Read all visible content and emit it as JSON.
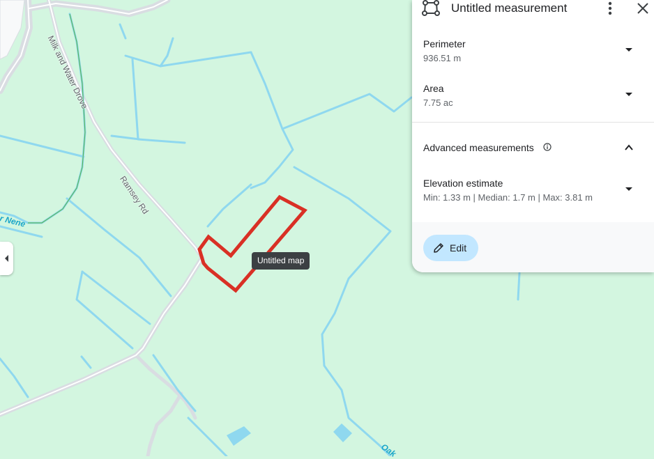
{
  "map": {
    "road_labels": {
      "milk_and_water_drove": "Milk and Water Drove",
      "ramsey_rd": "Ramsey Rd"
    },
    "water_labels": {
      "river_nene_partial": "r Nene",
      "oak_partial": "Oak"
    },
    "tooltip": "Untitled map",
    "colors": {
      "land": "#d3f6e0",
      "water": "#8fd8ef",
      "road": "#dadce0",
      "outline": "#d93025"
    }
  },
  "panel": {
    "title": "Untitled measurement",
    "perimeter": {
      "label": "Perimeter",
      "value": "936.51 m"
    },
    "area": {
      "label": "Area",
      "value": "7.75 ac"
    },
    "advanced": {
      "label": "Advanced measurements"
    },
    "elevation": {
      "label": "Elevation estimate",
      "value": "Min: 1.33 m | Median: 1.7 m | Max: 3.81 m"
    },
    "edit_label": "Edit"
  },
  "icons": [
    "polygon-measure-icon",
    "more-vert-icon",
    "close-icon",
    "chevron-down-icon",
    "chevron-up-icon",
    "info-icon",
    "pencil-icon",
    "chevron-left-icon"
  ]
}
